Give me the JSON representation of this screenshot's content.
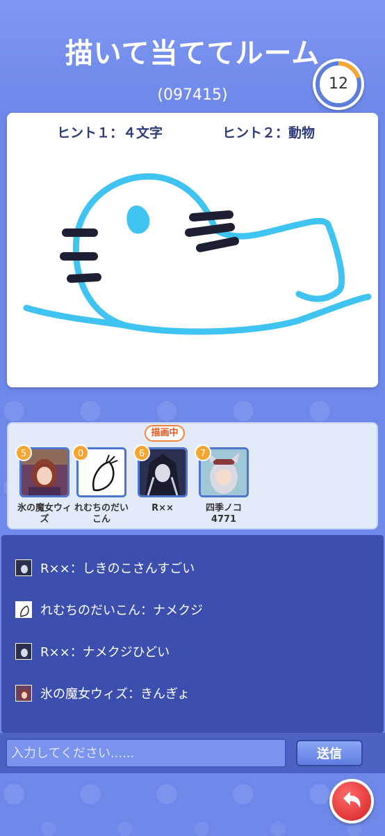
{
  "header": {
    "title": "描いて当ててルーム",
    "room_code": "(097415)",
    "timer": "12",
    "timer_progress": 0.2
  },
  "canvas": {
    "hint1": "ヒント１：４文字",
    "hint2": "ヒント２：動物"
  },
  "players": [
    {
      "score": "5",
      "name": "氷の魔女ウィズ"
    },
    {
      "score": "0",
      "name": "れむちのだいこん"
    },
    {
      "score": "6",
      "name": "R××"
    },
    {
      "score": "7",
      "name": "四季ノコ4771"
    }
  ],
  "drawing_badge": "描画中",
  "chat": [
    {
      "text": "R××：しきのこさんすごい",
      "icon": "rxx-avatar-icon"
    },
    {
      "text": "れむちのだいこん：ナメクジ",
      "icon": "daikon-avatar-icon"
    },
    {
      "text": "R××：ナメクジひどい",
      "icon": "rxx-avatar-icon"
    },
    {
      "text": "氷の魔女ウィズ：きんぎょ",
      "icon": "wiz-avatar-icon"
    }
  ],
  "input": {
    "placeholder": "入力してください......",
    "send_label": "送信"
  },
  "colors": {
    "accent": "#6e88ea",
    "chat_bg": "#3d4fae",
    "score_badge": "#f6a531",
    "drawing_stroke": "#3fc3f0"
  }
}
